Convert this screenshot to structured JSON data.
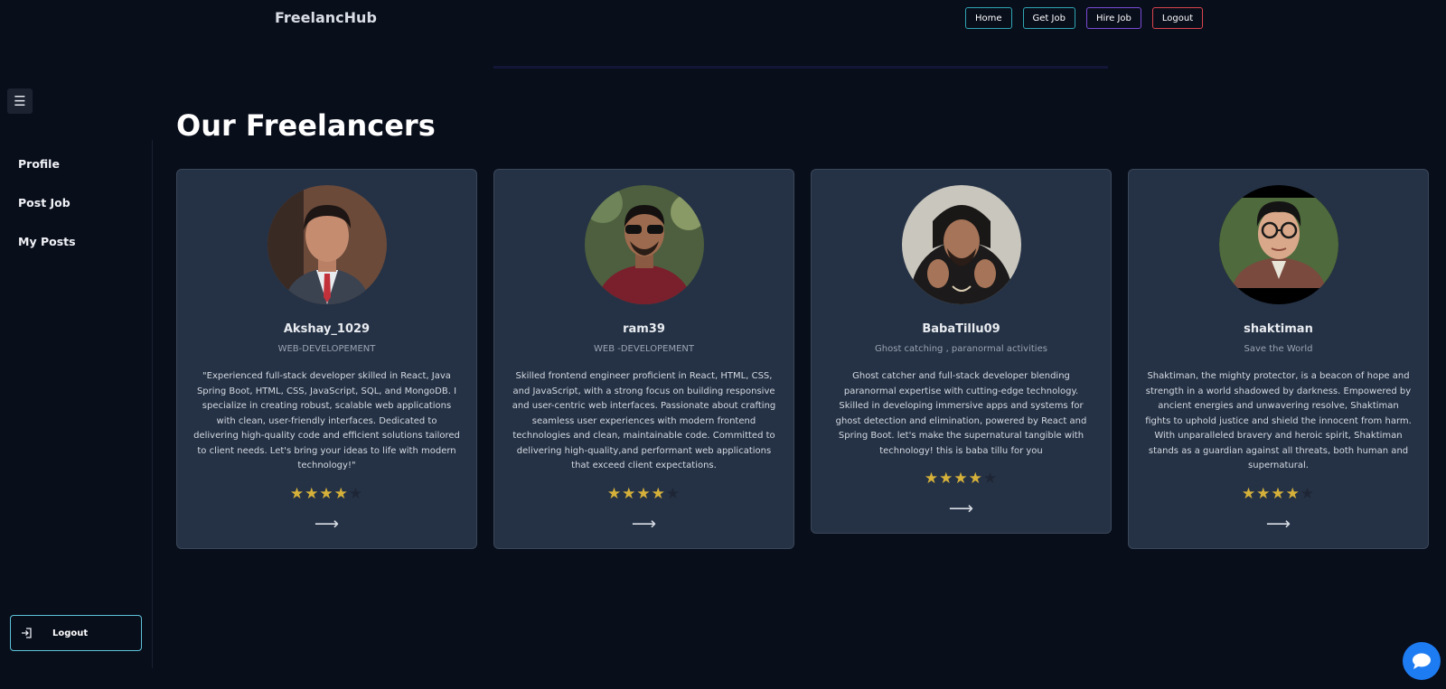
{
  "header": {
    "brand": "FreelancHub",
    "nav": [
      {
        "label": "Home"
      },
      {
        "label": "Get Job"
      },
      {
        "label": "Hire Job"
      },
      {
        "label": "Logout"
      }
    ]
  },
  "sidebar": {
    "toggle_icon": "hamburger-icon",
    "items": [
      {
        "label": "Profile"
      },
      {
        "label": "Post Job"
      },
      {
        "label": "My Posts"
      }
    ],
    "logout_label": "Logout",
    "logout_icon": "logout-icon"
  },
  "main": {
    "title": "Our Freelancers",
    "freelancers": [
      {
        "name": "Akshay_1029",
        "role": "WEB-DEVELOPEMENT",
        "description": "\"Experienced full-stack developer skilled in React, Java Spring Boot, HTML, CSS, JavaScript, SQL, and MongoDB. I specialize in creating robust, scalable web applications with clean, user-friendly interfaces. Dedicated to delivering high-quality code and efficient solutions tailored to client needs. Let's bring your ideas to life with modern technology!\"",
        "rating": 4,
        "rating_max": 5
      },
      {
        "name": "ram39",
        "role": "WEB -DEVELOPEMENT",
        "description": "Skilled frontend engineer proficient in React, HTML, CSS, and JavaScript, with a strong focus on building responsive and user-centric web interfaces. Passionate about crafting seamless user experiences with modern frontend technologies and clean, maintainable code. Committed to delivering high-quality,and performant web applications that exceed client expectations.",
        "rating": 4,
        "rating_max": 5
      },
      {
        "name": "BabaTillu09",
        "role": "Ghost catching , paranormal activities",
        "description": "Ghost catcher and full-stack developer blending paranormal expertise with cutting-edge technology. Skilled in developing immersive apps and systems for ghost detection and elimination, powered by React and Spring Boot. let's make the supernatural tangible with technology! this is baba tillu for you",
        "rating": 4,
        "rating_max": 5
      },
      {
        "name": "shaktiman",
        "role": "Save the World",
        "description": "Shaktiman, the mighty protector, is a beacon of hope and strength in a world shadowed by darkness. Empowered by ancient energies and unwavering resolve, Shaktiman fights to uphold justice and shield the innocent from harm. With unparalleled bravery and heroic spirit, Shaktiman stands as a guardian against all threats, both human and supernatural.",
        "rating": 4,
        "rating_max": 5
      }
    ],
    "arrow_glyph": "⟶",
    "star_glyph": "★"
  },
  "chat": {
    "icon": "chat-bubble-icon"
  },
  "colors": {
    "background": "#090e1b",
    "card": "#253245",
    "star_filled": "#d6b13a",
    "accent_teal": "#2fa5b3",
    "accent_purple": "#7a4bd6",
    "accent_red": "#d8454c",
    "chat_button": "#1e7cf2"
  }
}
